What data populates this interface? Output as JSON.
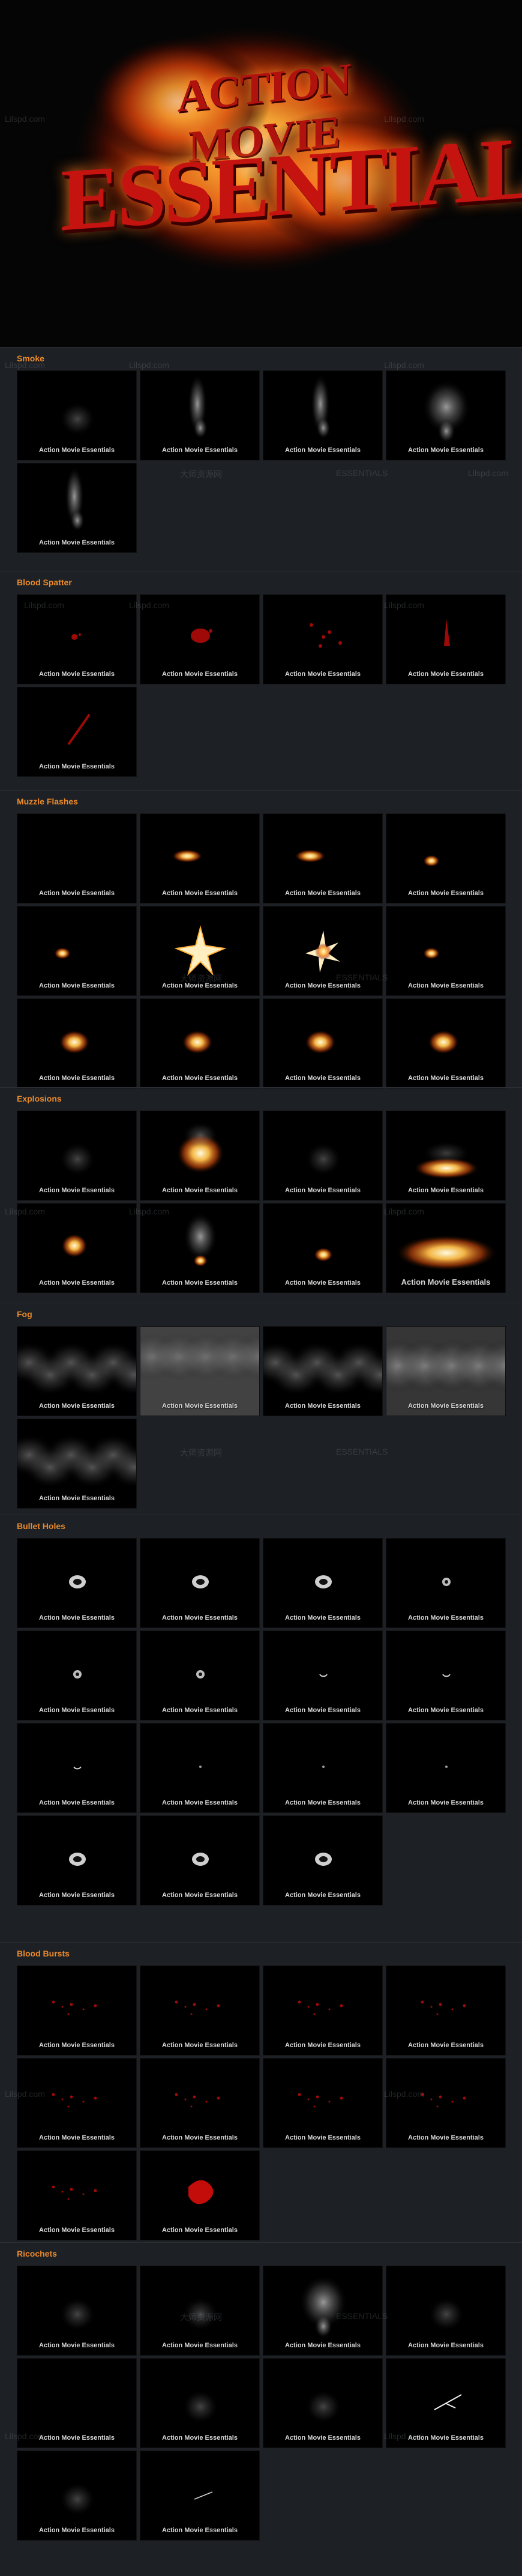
{
  "hero": {
    "line1": "ACTION MOVIE",
    "line2": "ESSENTIALS"
  },
  "watermarks": [
    "Lilspd.com",
    "大师资源网",
    "ESSENTIALS"
  ],
  "sections": [
    {
      "title": "Smoke",
      "caption": "Action Movie Essentials",
      "effects": [
        "smoke-faint",
        "smoke-column",
        "smoke-column",
        "smoke-large",
        "smoke-column"
      ]
    },
    {
      "title": "Blood Spatter",
      "caption": "Action Movie Essentials",
      "effects": [
        "blood-small",
        "blood-blob",
        "blood-scatter",
        "blood-drip",
        "blood-streak"
      ]
    },
    {
      "title": "Muzzle Flashes",
      "caption": "Action Movie Essentials",
      "effects": [
        "empty",
        "muzzle-side",
        "muzzle-side",
        "muzzle-small",
        "muzzle-small",
        "muzzle-star",
        "muzzle-burst",
        "muzzle-small",
        "fire-ball",
        "fire-ball",
        "fire-ball",
        "fire-ball"
      ]
    },
    {
      "title": "Explosions",
      "caption": "Action Movie Essentials",
      "effects": [
        "smoke-faint",
        "explosion-fire",
        "smoke-faint",
        "explosion-ground",
        "explosion-small",
        "explosion-smoke",
        "explosion-tiny",
        "explosion-wide"
      ]
    },
    {
      "title": "Fog",
      "caption": "Action Movie Essentials",
      "effects": [
        "fog-dense",
        "fog-light",
        "fog-dense",
        "fog-bright",
        "fog-dense"
      ]
    },
    {
      "title": "Bullet Holes",
      "caption": "Action Movie Essentials",
      "effects": [
        "hole-big",
        "hole-big",
        "hole-big",
        "hole-small",
        "hole-small",
        "hole-small",
        "hole-tiny",
        "hole-tiny",
        "hole-tiny",
        "hole-dot",
        "hole-dot",
        "hole-dot",
        "hole-big",
        "hole-big",
        "hole-big"
      ]
    },
    {
      "title": "Blood Bursts",
      "caption": "Action Movie Essentials",
      "effects": [
        "blood-spray",
        "blood-spray",
        "blood-spray",
        "blood-spray",
        "blood-spray",
        "blood-spray",
        "blood-spray",
        "blood-spray",
        "blood-spray",
        "blood-splash"
      ]
    },
    {
      "title": "Ricochets",
      "caption": "Action Movie Essentials",
      "effects": [
        "smoke-faint",
        "smoke-faint",
        "smoke-large",
        "smoke-faint",
        "empty",
        "smoke-faint",
        "smoke-faint",
        "spark",
        "smoke-faint",
        "spark-small"
      ]
    }
  ]
}
